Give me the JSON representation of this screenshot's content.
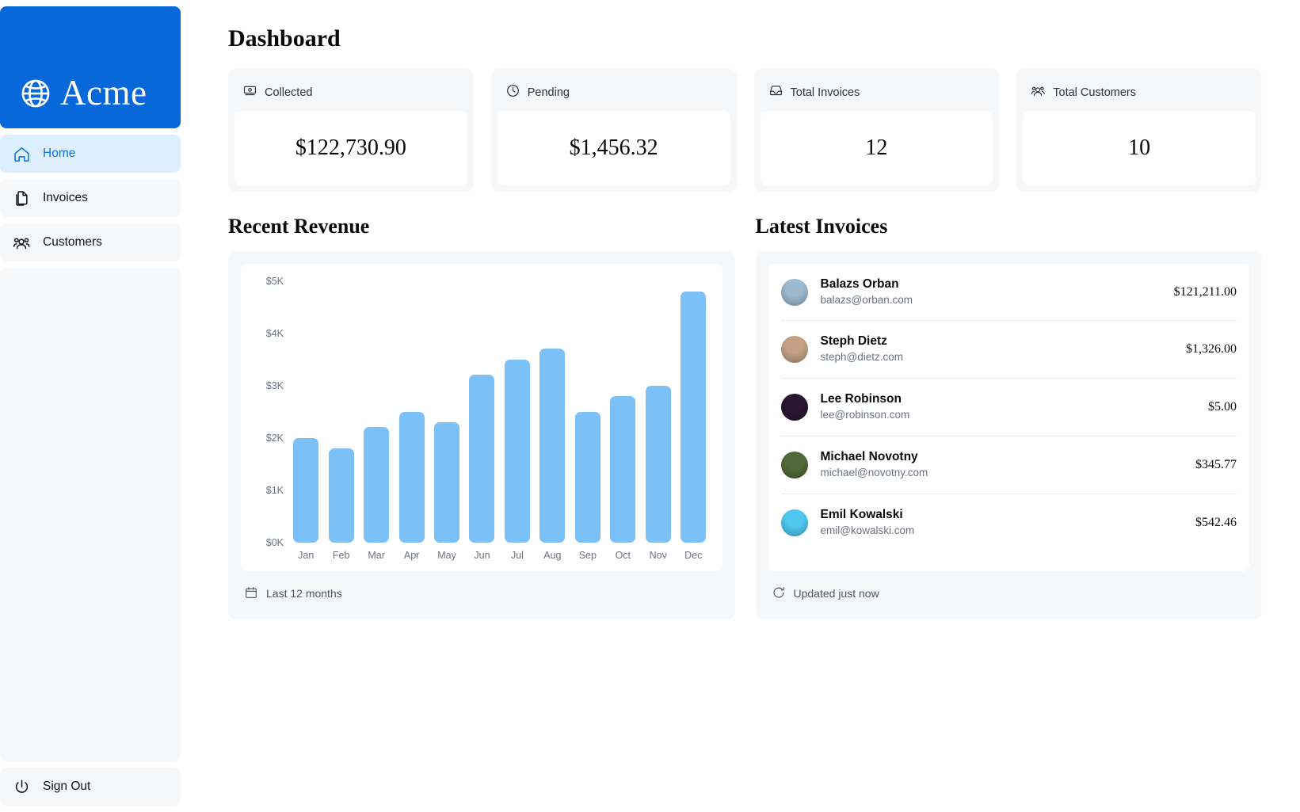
{
  "sidebar": {
    "logo": {
      "text": "Acme",
      "icon": "globe-icon",
      "bg_color": "#0868d9"
    },
    "items": [
      {
        "label": "Home",
        "icon": "home-icon",
        "active": true
      },
      {
        "label": "Invoices",
        "icon": "document-duplicate-icon",
        "active": false
      },
      {
        "label": "Customers",
        "icon": "user-group-icon",
        "active": false
      }
    ],
    "sign_out": {
      "label": "Sign Out",
      "icon": "power-icon"
    }
  },
  "main": {
    "page_title": "Dashboard",
    "cards": [
      {
        "label": "Collected",
        "value": "$122,730.90",
        "icon": "banknotes-icon"
      },
      {
        "label": "Pending",
        "value": "$1,456.32",
        "icon": "clock-icon"
      },
      {
        "label": "Total Invoices",
        "value": "12",
        "icon": "inbox-icon"
      },
      {
        "label": "Total Customers",
        "value": "10",
        "icon": "user-group-icon"
      }
    ],
    "revenue": {
      "title": "Recent Revenue",
      "footer": {
        "label": "Last 12 months",
        "icon": "calendar-icon"
      }
    },
    "invoices": {
      "title": "Latest Invoices",
      "footer": {
        "label": "Updated just now",
        "icon": "arrow-path-icon"
      },
      "rows": [
        {
          "name": "Balazs Orban",
          "email": "balazs@orban.com",
          "amount": "$121,211.00",
          "avatar_color": "#9db9cf"
        },
        {
          "name": "Steph Dietz",
          "email": "steph@dietz.com",
          "amount": "$1,326.00",
          "avatar_color": "#c2a184"
        },
        {
          "name": "Lee Robinson",
          "email": "lee@robinson.com",
          "amount": "$5.00",
          "avatar_color": "#2a1630"
        },
        {
          "name": "Michael Novotny",
          "email": "michael@novotny.com",
          "amount": "$345.77",
          "avatar_color": "#51693a"
        },
        {
          "name": "Emil Kowalski",
          "email": "emil@kowalski.com",
          "amount": "$542.46",
          "avatar_color": "#4fc7f0"
        }
      ]
    }
  },
  "chart_data": {
    "type": "bar",
    "title": "Recent Revenue",
    "xlabel": "",
    "ylabel": "",
    "categories": [
      "Jan",
      "Feb",
      "Mar",
      "Apr",
      "May",
      "Jun",
      "Jul",
      "Aug",
      "Sep",
      "Oct",
      "Nov",
      "Dec"
    ],
    "values": [
      2000,
      1800,
      2200,
      2500,
      2300,
      3200,
      3500,
      3700,
      2500,
      2800,
      3000,
      4800
    ],
    "y_ticks": [
      "$0K",
      "$1K",
      "$2K",
      "$3K",
      "$4K",
      "$5K"
    ],
    "y_tick_values": [
      0,
      1000,
      2000,
      3000,
      4000,
      5000
    ],
    "ylim": [
      0,
      5000
    ],
    "grid": false,
    "legend": null,
    "bar_color": "#7cc0f8"
  }
}
